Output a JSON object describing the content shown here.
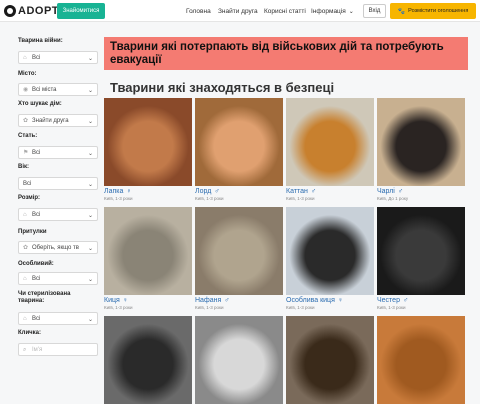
{
  "header": {
    "logo_text": "ADOPT",
    "teal_button": "Знайомитися",
    "nav": [
      "Головна",
      "Знайти друга",
      "Корисні статті",
      "Інформація"
    ],
    "login": "Вхід",
    "post_button": "Розмістити оголошення"
  },
  "filters": [
    {
      "label": "Тварина війни:",
      "value": "Всі",
      "icon": "house-icon"
    },
    {
      "label": "Місто:",
      "value": "Всі міста",
      "icon": "pin-icon"
    },
    {
      "label": "Хто шукає дім:",
      "value": "Знайти друга",
      "icon": "paw-icon"
    },
    {
      "label": "Стать:",
      "value": "Всі",
      "icon": "flag-icon"
    },
    {
      "label": "Вік:",
      "value": "Всі",
      "icon": ""
    },
    {
      "label": "Розмір:",
      "value": "Всі",
      "icon": "house-icon"
    },
    {
      "label": "Притулки",
      "value": "Оберіть, якщо тв",
      "icon": "paw-icon"
    },
    {
      "label": "Особливий:",
      "value": "Всі",
      "icon": "house-icon"
    },
    {
      "label": "Чи стерилізована тварина:",
      "value": "Всі",
      "icon": "house-icon"
    },
    {
      "label": "Кличка:",
      "value": "",
      "placeholder": "Ім'я",
      "icon": "search-icon"
    }
  ],
  "banner": "Тварини які потерпають від військових дій та потребують евакуації",
  "section_title": "Тварини які знаходяться в безпеці",
  "pets": [
    {
      "name": "Лапка",
      "sex": "♀",
      "meta": "Київ, 1-3 роки",
      "bg": "#8a4a2a",
      "fg": "#c27a4a"
    },
    {
      "name": "Лорд",
      "sex": "♂",
      "meta": "Київ, 1-3 роки",
      "bg": "#a06a3a",
      "fg": "#e0a070"
    },
    {
      "name": "Каттан",
      "sex": "♂",
      "meta": "Київ, 1-3 роки",
      "bg": "#cfc8b8",
      "fg": "#c8802e"
    },
    {
      "name": "Чарлі",
      "sex": "♂",
      "meta": "Київ, До 1 року",
      "bg": "#c8b090",
      "fg": "#2a2422"
    },
    {
      "name": "Киця",
      "sex": "♀",
      "meta": "Київ, 1-3 роки",
      "bg": "#b8b0a0",
      "fg": "#8a8476"
    },
    {
      "name": "Нафаня",
      "sex": "♂",
      "meta": "Київ, 1-3 роки",
      "bg": "#8a7c6a",
      "fg": "#b0a48e"
    },
    {
      "name": "Особлива киця",
      "sex": "♀",
      "meta": "Київ, 1-3 роки",
      "bg": "#c8d0d8",
      "fg": "#2a2a2a"
    },
    {
      "name": "Честер",
      "sex": "♂",
      "meta": "Київ, 1-3 роки",
      "bg": "#1a1a1a",
      "fg": "#3a3a3a"
    },
    {
      "name": "",
      "sex": "",
      "meta": "",
      "bg": "#6a6a6a",
      "fg": "#2a2a2a"
    },
    {
      "name": "",
      "sex": "",
      "meta": "",
      "bg": "#8a8a8a",
      "fg": "#d8d8d8"
    },
    {
      "name": "",
      "sex": "",
      "meta": "",
      "bg": "#7a6a5a",
      "fg": "#3a2a1a"
    },
    {
      "name": "",
      "sex": "",
      "meta": "",
      "bg": "#c87a3a",
      "fg": "#a05a20"
    }
  ]
}
